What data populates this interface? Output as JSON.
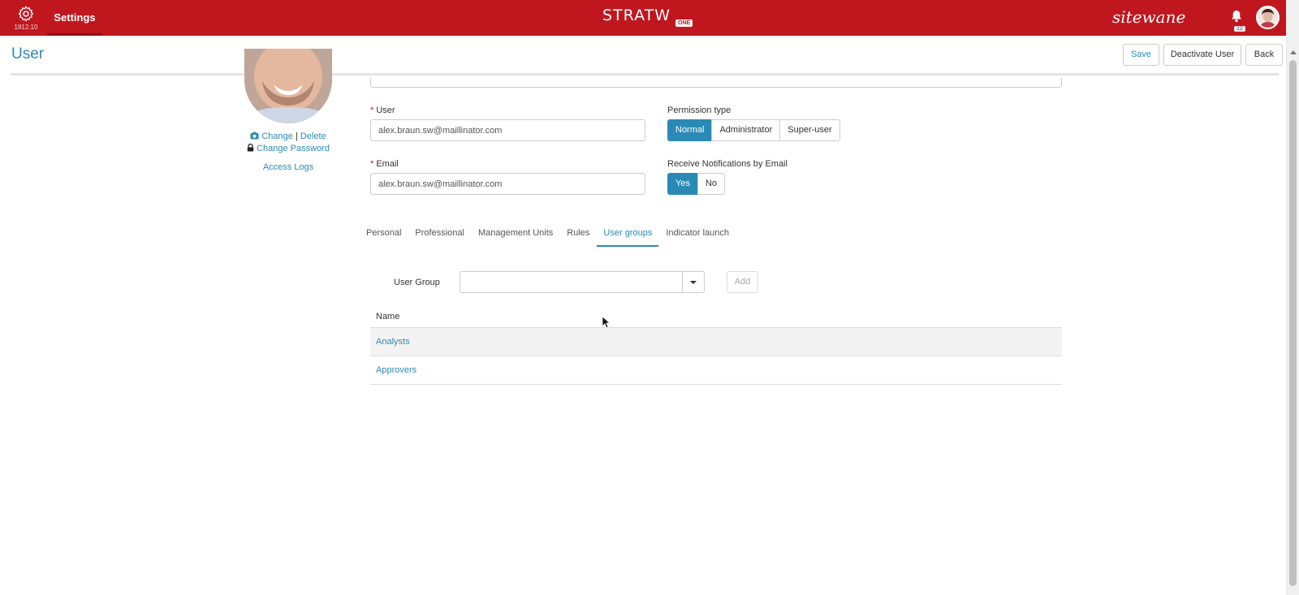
{
  "topbar": {
    "version": "1812.10",
    "settings_tab": "Settings",
    "brand_name": "STRATW",
    "brand_badge": "ONE",
    "vendor_logo": "sitewane",
    "notification_count": "12",
    "bar_color": "#c0171f"
  },
  "header": {
    "title": "User",
    "save_label": "Save",
    "deactivate_label": "Deactivate User",
    "back_label": "Back"
  },
  "profile": {
    "change_label": "Change",
    "separator": "|",
    "delete_label": "Delete",
    "change_password_label": "Change Password",
    "access_logs_label": "Access Logs"
  },
  "form": {
    "required_mark": "*",
    "user_label": "User",
    "user_value": "alex.braun.sw@maillinator.com",
    "email_label": "Email",
    "email_value": "alex.braun.sw@maillinator.com",
    "permission_label": "Permission type",
    "permission_options": [
      "Normal",
      "Administrator",
      "Super-user"
    ],
    "permission_selected": "Normal",
    "notifications_label": "Receive Notifications by Email",
    "notifications_options": [
      "Yes",
      "No"
    ],
    "notifications_selected": "Yes"
  },
  "tabs": [
    {
      "label": "Personal",
      "active": false
    },
    {
      "label": "Professional",
      "active": false
    },
    {
      "label": "Management Units",
      "active": false
    },
    {
      "label": "Rules",
      "active": false
    },
    {
      "label": "User groups",
      "active": true
    },
    {
      "label": "Indicator launch",
      "active": false
    }
  ],
  "user_groups": {
    "select_label": "User Group",
    "select_value": "",
    "add_label": "Add",
    "table_header": "Name",
    "rows": [
      "Analysts",
      "Approvers"
    ]
  },
  "colors": {
    "accent": "#2a8ab5",
    "required": "#c0171f"
  }
}
